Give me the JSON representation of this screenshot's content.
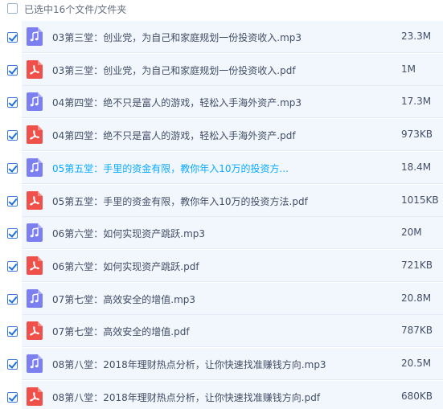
{
  "header": {
    "selected_text": "已选中16个文件/文件夹"
  },
  "files": [
    {
      "name": "03第三堂：创业党，为自己和家庭规划一份投资收入.mp3",
      "size": "23.3M",
      "type": "mp3",
      "checked": true
    },
    {
      "name": "03第三堂：创业党，为自己和家庭规划一份投资收入.pdf",
      "size": "1M",
      "type": "pdf",
      "checked": true
    },
    {
      "name": "04第四堂：绝不只是富人的游戏，轻松入手海外资产.mp3",
      "size": "17.3M",
      "type": "mp3",
      "checked": true
    },
    {
      "name": "04第四堂：绝不只是富人的游戏，轻松入手海外资产.pdf",
      "size": "973KB",
      "type": "pdf",
      "checked": true
    },
    {
      "name": "05第五堂：手里的资金有限，教你年入10万的投资方...",
      "size": "18.4M",
      "type": "mp3",
      "checked": true,
      "hot": true
    },
    {
      "name": "05第五堂：手里的资金有限，教你年入10万的投资方法.pdf",
      "size": "1015KB",
      "type": "pdf",
      "checked": true
    },
    {
      "name": "06第六堂：如何实现资产跳跃.mp3",
      "size": "20M",
      "type": "mp3",
      "checked": true
    },
    {
      "name": "06第六堂：如何实现资产跳跃.pdf",
      "size": "721KB",
      "type": "pdf",
      "checked": true
    },
    {
      "name": "07第七堂：高效安全的增值.mp3",
      "size": "20.8M",
      "type": "mp3",
      "checked": true
    },
    {
      "name": "07第七堂：高效安全的增值.pdf",
      "size": "787KB",
      "type": "pdf",
      "checked": true
    },
    {
      "name": "08第八堂：2018年理财热点分析，让你快速找准赚钱方向.mp3",
      "size": "20.5M",
      "type": "mp3",
      "checked": true
    },
    {
      "name": "08第八堂：2018年理财热点分析，让你快速找准赚钱方向.pdf",
      "size": "680KB",
      "type": "pdf",
      "checked": true
    }
  ],
  "colors": {
    "mp3_icon": "#7b7ff0",
    "pdf_icon": "#f0504a",
    "highlight_text": "#09aaff",
    "row_bg": "#f2f7fd",
    "check": "#1e6fd9"
  },
  "icons": {
    "mp3": "music-note-icon",
    "pdf": "pdf-acrobat-icon"
  }
}
